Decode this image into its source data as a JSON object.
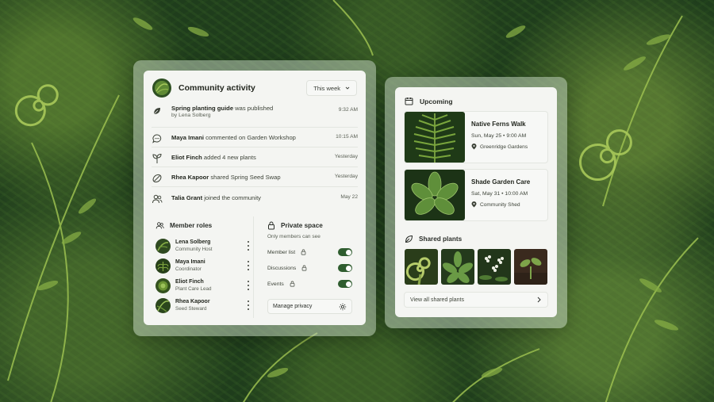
{
  "community": {
    "title": "Community activity",
    "period": "This week",
    "activities": [
      {
        "icon": "leaf-icon",
        "actor": "Spring planting guide",
        "action": " was published",
        "sub": "by Lena Solberg",
        "time": "9:32 AM"
      },
      {
        "icon": "comment-icon",
        "actor": "Maya Imani",
        "action": " commented on Garden Workshop",
        "sub": "",
        "time": "10:15 AM"
      },
      {
        "icon": "sprout-icon",
        "actor": "Eliot Finch",
        "action": " added 4 new plants",
        "sub": "",
        "time": "Yesterday"
      },
      {
        "icon": "seed-icon",
        "actor": "Rhea Kapoor",
        "action": " shared Spring Seed Swap",
        "sub": "",
        "time": "Yesterday"
      },
      {
        "icon": "users-icon",
        "actor": "Talia Grant",
        "action": " joined the community",
        "sub": "",
        "time": "May 22"
      }
    ]
  },
  "member_roles": {
    "title": "Member roles",
    "members": [
      {
        "name": "Lena Solberg",
        "role": "Community Host"
      },
      {
        "name": "Maya Imani",
        "role": "Coordinator"
      },
      {
        "name": "Eliot Finch",
        "role": "Plant Care Lead"
      },
      {
        "name": "Rhea Kapoor",
        "role": "Seed Steward"
      }
    ]
  },
  "private_space": {
    "title": "Private space",
    "subtitle": "Only members can see",
    "settings": [
      {
        "label": "Member list",
        "enabled": true
      },
      {
        "label": "Discussions",
        "enabled": true
      },
      {
        "label": "Events",
        "enabled": true
      }
    ],
    "manage_label": "Manage privacy"
  },
  "upcoming": {
    "title": "Upcoming",
    "events": [
      {
        "name": "Native Ferns Walk",
        "date": "Sun, May 25 • 9:00 AM",
        "location": "Greenridge Gardens"
      },
      {
        "name": "Shade Garden Care",
        "date": "Sat, May 31 • 10:00 AM",
        "location": "Community Shed"
      }
    ]
  },
  "shared_plants": {
    "title": "Shared plants",
    "thumbnails": [
      "fern-fiddlehead",
      "hosta-leaves",
      "white-flowers",
      "seedling"
    ],
    "view_all_label": "View all shared plants"
  },
  "colors": {
    "toggle_on": "#2f5d2f",
    "card_bg": "#f4f5f2",
    "background": "#1f3d1c"
  }
}
